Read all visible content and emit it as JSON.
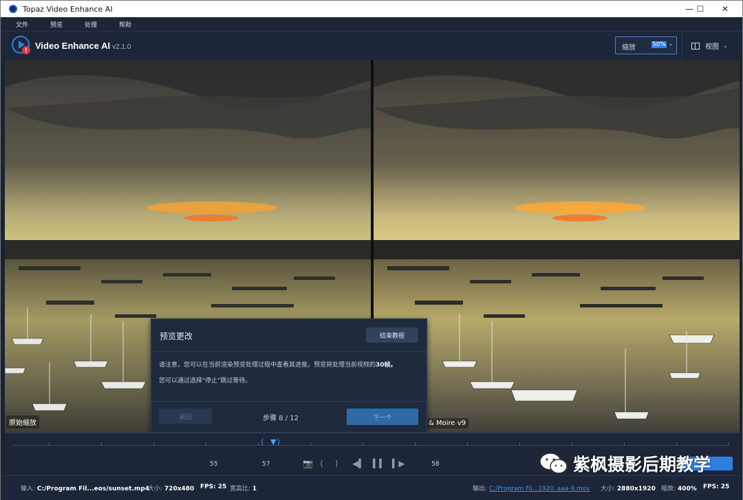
{
  "window": {
    "title": "Topaz Video Enhance AI",
    "minimize_glyph": "—",
    "maximize_glyph": "☐",
    "close_glyph": "✕"
  },
  "menu": [
    "文件",
    "预览",
    "处理",
    "帮助"
  ],
  "header": {
    "app_name": "Video Enhance AI",
    "version": "v2.1.0",
    "zoom_label": "缩放",
    "zoom_value": "50%",
    "view_label": "视图"
  },
  "preview": {
    "left_label": "原始缩放",
    "right_label": "& Moire v9"
  },
  "dialog": {
    "title": "预览更改",
    "end_tutorial": "结束教程",
    "body_line1": "请注意，您可以在当前渲染预览处理过程中查看其进度。预览将处理当前视频的",
    "body_line1_bold": "30帧。",
    "body_line2": "您可以通过选择\"停止\"跳过等待。",
    "back": "返回",
    "step": "步骤 8 / 12",
    "next": "下一个"
  },
  "timeline": {
    "labels": [
      "55",
      "57",
      "58"
    ]
  },
  "status": {
    "input_label": "输入:",
    "input_path": "C:/Program Fil...eos/sunset.mp4",
    "size_label": "大小:",
    "size_value": "720x480",
    "fps_label": "FPS:",
    "fps_value": "25",
    "aspect_label": "宽高比:",
    "aspect_value": "1",
    "output_label": "输出:",
    "output_path": "C:/Program Fil...1920_aaa-9.mov",
    "out_size_label": "大小:",
    "out_size_value": "2880x1920",
    "out_zoom_label": "缩放:",
    "out_zoom_value": "400%",
    "out_fps_label": "FPS:",
    "out_fps_value": "25"
  },
  "watermark": {
    "text": "紫枫摄影后期教学"
  },
  "colors": {
    "accent": "#2f7fe0",
    "bg": "#1c2638",
    "link": "#4a92e0"
  }
}
